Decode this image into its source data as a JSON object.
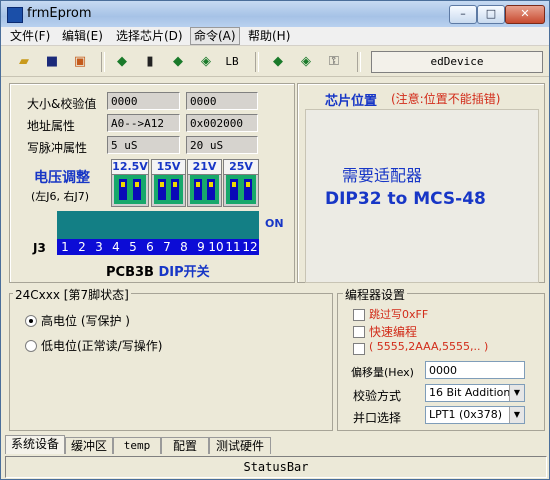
{
  "window": {
    "title": "frmEprom",
    "min_label": "–",
    "max_label": "□",
    "close_label": "✕"
  },
  "menu": [
    "文件(F)",
    "编辑(E)",
    "选择芯片(D)",
    "命令(A)",
    "帮助(H)"
  ],
  "toolbar": {
    "device_label": "edDevice",
    "lb_label": "LB"
  },
  "info": {
    "size_label": "大小&校验值",
    "addr_label": "地址属性",
    "pulse_label": "写脉冲属性",
    "size_val1": "0000",
    "size_val2": "0000",
    "addr_val1": "A0-->A12",
    "addr_val2": "0x002000",
    "pulse_val1": "5 uS",
    "pulse_val2": "20 uS"
  },
  "voltage": {
    "title": "电压调整",
    "subtitle": "(左J6, 右J7)",
    "labels": [
      "12.5V",
      "15V",
      "21V",
      "25V"
    ]
  },
  "dip": {
    "on_label": "ON",
    "j3_label": "J3",
    "numbers": [
      "1",
      "2",
      "3",
      "4",
      "5",
      "6",
      "7",
      "8",
      "9",
      "10",
      "11",
      "12"
    ],
    "pcb_prefix": "PCB3B ",
    "pcb_suffix": "DIP开关"
  },
  "chip": {
    "title": "芯片位置",
    "note": "(注意:位置不能插错)",
    "need_adapter": "需要适配器",
    "adapter_name": "DIP32 to MCS-48"
  },
  "pin_state": {
    "title": "24Cxxx [第7脚状态]",
    "opt_high": "高电位 (写保护 )",
    "opt_low": "低电位(正常读/写操作)"
  },
  "programmer": {
    "title": "编程器设置",
    "skip_ff": "跳过写0xFF",
    "fast_prog": "快速编程",
    "seq_label": "( 5555,2AAA,5555,.. )",
    "offset_label": "偏移量(Hex)",
    "offset_value": "0000",
    "checksum_label": "校验方式",
    "checksum_value": "16 Bit Addition",
    "port_label": "并口选择",
    "port_value": "LPT1 (0x378)"
  },
  "tabs": [
    "系统设备",
    "缓冲区",
    "temp",
    "配置",
    "测试硬件"
  ],
  "status": {
    "text": "StatusBar"
  },
  "colors": {
    "accent_blue": "#1736c6",
    "chip_red": "#d22c1a",
    "dip_blue": "#0c0cd6",
    "dip_green": "#17a86b"
  }
}
